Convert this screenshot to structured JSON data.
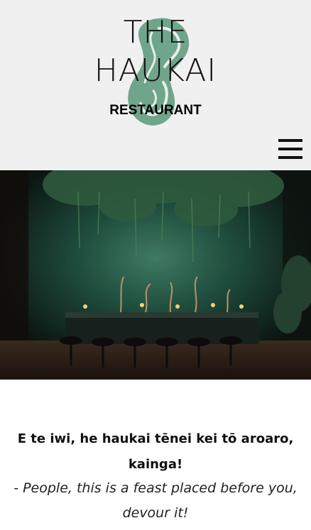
{
  "header": {
    "logo": {
      "line1": "THE",
      "line2": "HAUKAI",
      "subtitle": "RESTAURANT",
      "emblem_icon": "pounamu-hook-icon",
      "emblem_color": "#6fa58a"
    },
    "menu_icon": "hamburger-menu-icon"
  },
  "hero": {
    "image": "dining-room-photo",
    "accent": "#1f3f33"
  },
  "quote": {
    "maori": "E te iwi, he haukai tēnei kei tō aroaro, kainga!",
    "translation": "- People, this is a feast placed before you, devour it!"
  }
}
